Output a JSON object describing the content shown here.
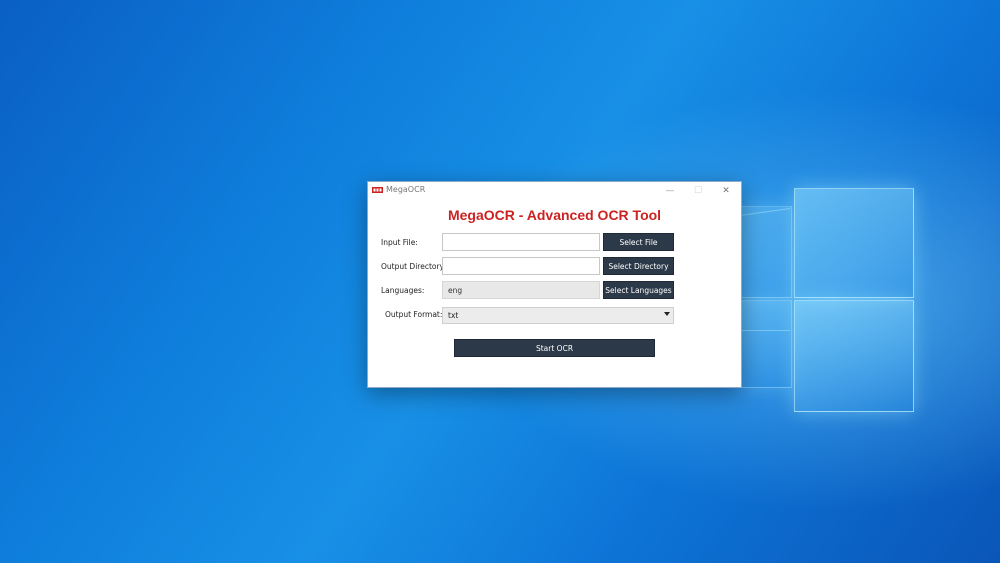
{
  "window": {
    "title": "MegaOCR",
    "controls": {
      "minimize": "—",
      "maximize": "☐",
      "close": "✕"
    }
  },
  "header": {
    "title": "MegaOCR - Advanced OCR Tool",
    "color": "#cc2222"
  },
  "form": {
    "input_file": {
      "label": "Input File:",
      "value": "",
      "button": "Select File"
    },
    "output_directory": {
      "label": "Output Directory:",
      "value": "",
      "button": "Select Directory"
    },
    "languages": {
      "label": "Languages:",
      "value": "eng",
      "button": "Select Languages"
    },
    "output_format": {
      "label": "Output Format:",
      "selected": "txt"
    },
    "start_button": "Start OCR"
  },
  "colors": {
    "button_bg": "#2c3949",
    "desktop_bg": "#0f7fdc"
  },
  "icons": {
    "app_icon": "megaocr-logo-icon",
    "dropdown": "chevron-down-icon"
  }
}
